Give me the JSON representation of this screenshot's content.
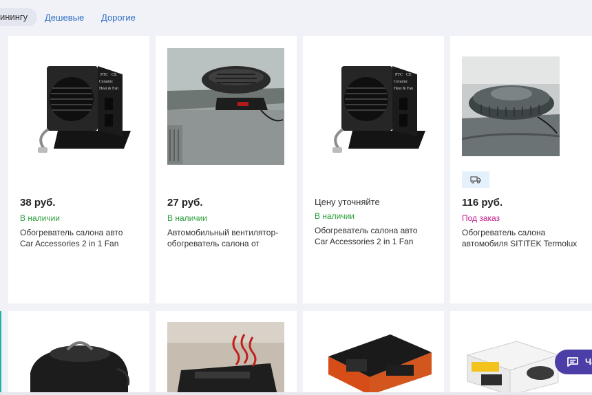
{
  "filters": {
    "active_chip": "инингу",
    "links": [
      "Дешевые",
      "Дорогие"
    ]
  },
  "products": [
    {
      "image": "ptc-ceramic-heater-photo",
      "price": "38 руб.",
      "availability": "В наличии",
      "title_line1": "Обогреватель салона авто",
      "title_line2": "Car Accessories 2 in 1 Fan"
    },
    {
      "image": "dashboard-heater-photo",
      "price": "27 руб.",
      "availability": "В наличии",
      "title_line1": "Автомобильный вентилятор-",
      "title_line2": "обогреватель салона от"
    },
    {
      "image": "ptc-ceramic-heater-photo",
      "price_note": "Цену уточняйте",
      "availability": "В наличии",
      "title_line1": "Обогреватель салона авто",
      "title_line2": "Car Accessories 2 in 1 Fan"
    },
    {
      "image": "sititek-heater-photo",
      "delivery_icon": "truck-icon",
      "price": "116 руб.",
      "availability": "Под заказ",
      "title_line1": "Обогреватель салона",
      "title_line2": "автомобиля SITITEK Termolux"
    }
  ],
  "image_text": {
    "ptc": "PTC",
    "ce": "CE",
    "ceramic": "Ceramic",
    "heat_fan": "Heat & Fan"
  },
  "chat": {
    "label": "Ча",
    "icon": "chat-icon"
  },
  "colors": {
    "in_stock": "#2a9d3a",
    "on_order": "#c2188b",
    "link": "#2f6fc4",
    "chat_bg": "#4b3ea6",
    "background": "#f1f2f7"
  }
}
